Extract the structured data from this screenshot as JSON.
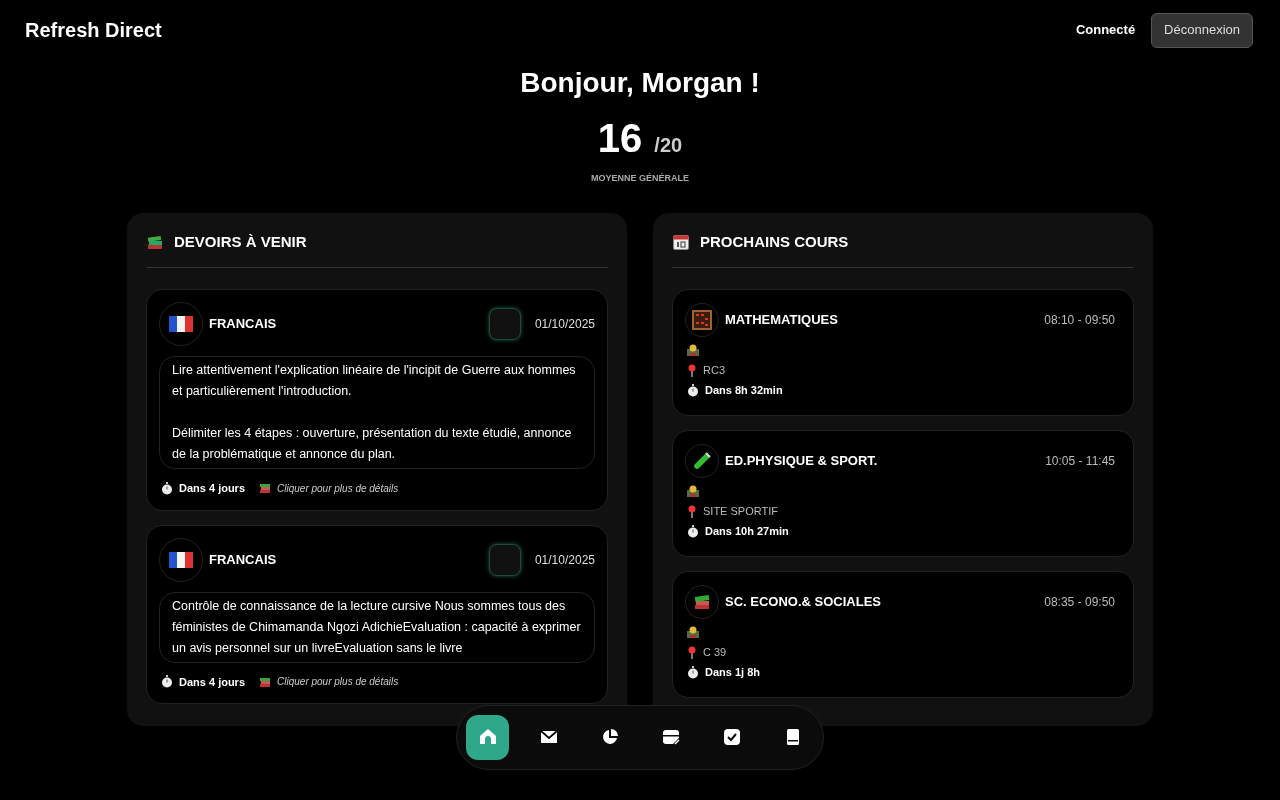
{
  "app_title": "Refresh Direct",
  "header": {
    "status": "Connecté",
    "logout_button": "Déconnexion"
  },
  "greeting": "Bonjour, Morgan !",
  "average": {
    "value": "16",
    "scale": "/20",
    "label": "MOYENNE GÉNÉRALE"
  },
  "homework": {
    "title": "DEVOIRS À VENIR",
    "items": [
      {
        "subject": "FRANCAIS",
        "kind": "flag",
        "checked": false,
        "date": "01/10/2025",
        "description": "Lire attentivement l'explication linéaire de l'incipit de Guerre aux hommes et particulièrement l'introduction.\n\nDélimiter les 4 étapes : ouverture, présentation du texte étudié, annonce de la problématique et annonce du plan.",
        "due": "Dans 4 jours",
        "hint": "Cliquer pour plus de détails"
      },
      {
        "subject": "FRANCAIS",
        "kind": "flag",
        "checked": false,
        "date": "01/10/2025",
        "description": "Contrôle de connaissance de la lecture cursive Nous sommes tous des féministes de Chimamanda Ngozi AdichieEvaluation : capacité à exprimer un avis personnel sur un livreEvaluation sans le livre",
        "due": "Dans 4 jours",
        "hint": "Cliquer pour plus de détails"
      }
    ]
  },
  "courses": {
    "title": "PROCHAINS COURS",
    "items": [
      {
        "subject": "MATHEMATIQUES",
        "kind": "abacus",
        "time": "08:10 - 09:50",
        "room": "RC3",
        "starts_in": "Dans 8h 32min"
      },
      {
        "subject": "ED.PHYSIQUE & SPORT.",
        "kind": "tube",
        "time": "10:05 - 11:45",
        "room": "SITE SPORTIF",
        "starts_in": "Dans 10h 27min"
      },
      {
        "subject": "SC. ECONO.& SOCIALES",
        "kind": "books",
        "time": "08:35 - 09:50",
        "room": "C 39",
        "starts_in": "Dans 1j 8h"
      }
    ]
  },
  "nav": [
    {
      "kind": "home",
      "selected": true
    },
    {
      "kind": "mail",
      "selected": false
    },
    {
      "kind": "chart",
      "selected": false
    },
    {
      "kind": "schedule",
      "selected": false
    },
    {
      "kind": "check",
      "selected": false
    },
    {
      "kind": "book",
      "selected": false
    }
  ]
}
